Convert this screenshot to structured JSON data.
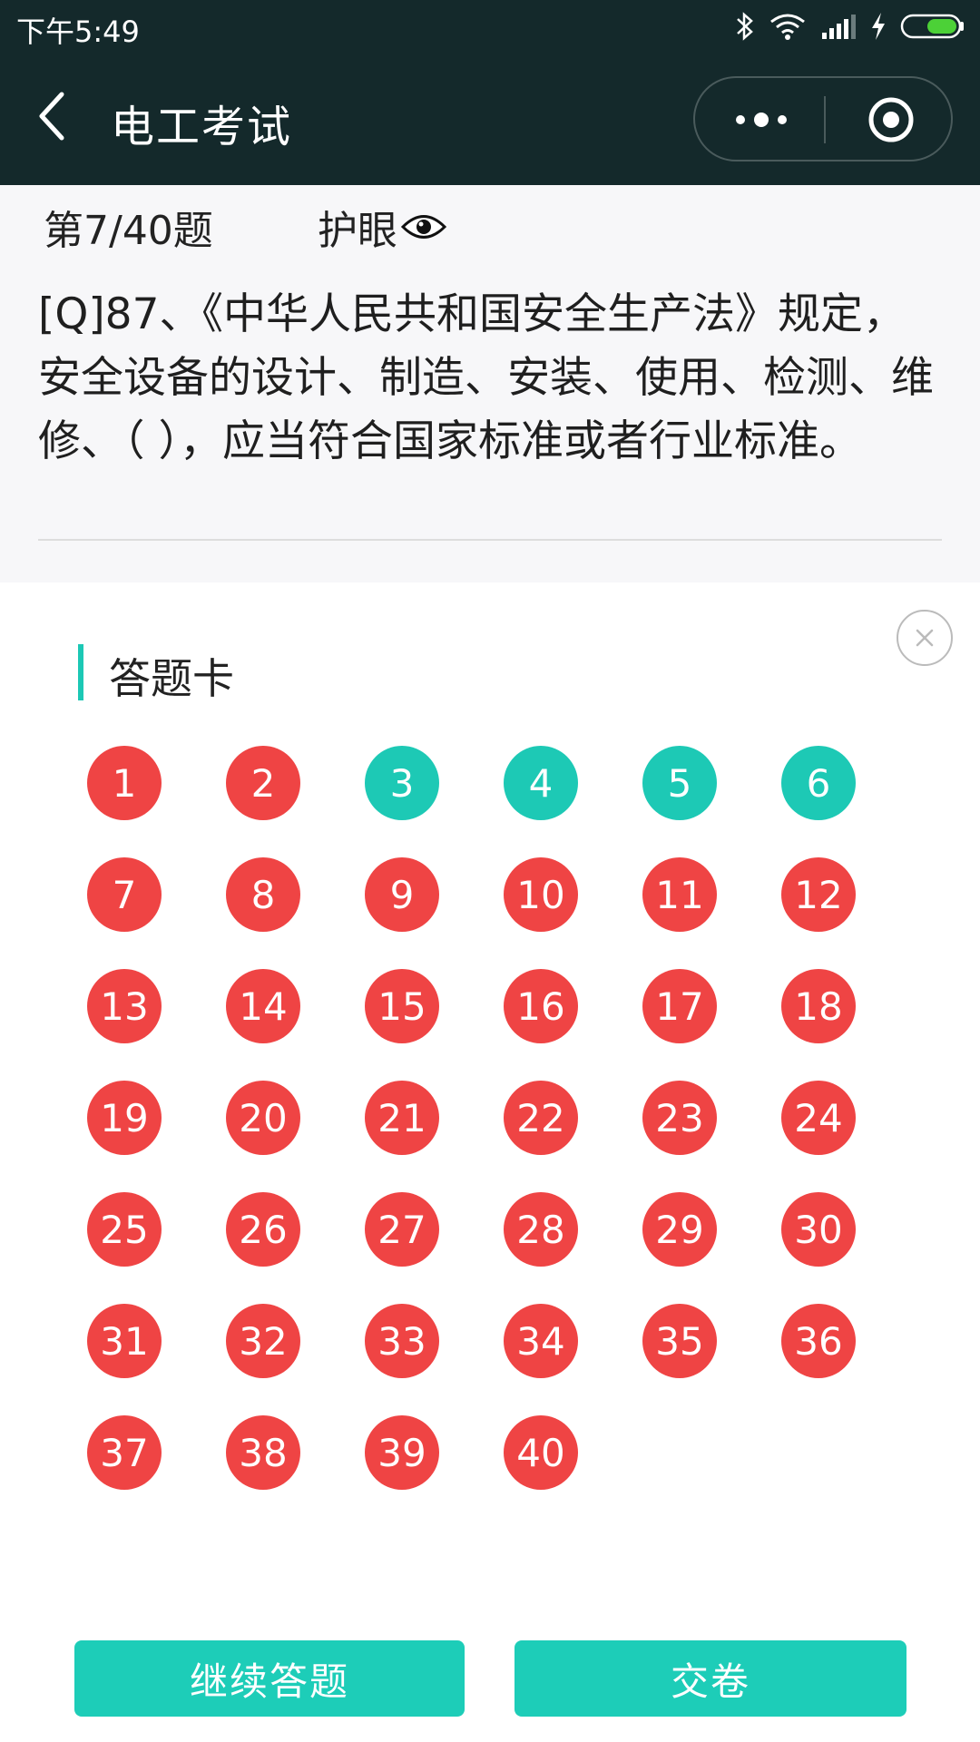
{
  "status_bar": {
    "time": "下午5:49"
  },
  "nav": {
    "title": "电工考试"
  },
  "question": {
    "progress": "第7/40题",
    "eye_mode_label": "护眼",
    "text": "[Q]87、《中华人民共和国安全生产法》规定，安全设备的设计、制造、安装、使用、检测、维修、（ ），应当符合国家标准或者行业标准。"
  },
  "answer_sheet": {
    "title": "答题卡",
    "items": [
      {
        "num": "1",
        "status": "wrong"
      },
      {
        "num": "2",
        "status": "wrong"
      },
      {
        "num": "3",
        "status": "correct"
      },
      {
        "num": "4",
        "status": "correct"
      },
      {
        "num": "5",
        "status": "correct"
      },
      {
        "num": "6",
        "status": "correct"
      },
      {
        "num": "7",
        "status": "wrong"
      },
      {
        "num": "8",
        "status": "wrong"
      },
      {
        "num": "9",
        "status": "wrong"
      },
      {
        "num": "10",
        "status": "wrong"
      },
      {
        "num": "11",
        "status": "wrong"
      },
      {
        "num": "12",
        "status": "wrong"
      },
      {
        "num": "13",
        "status": "wrong"
      },
      {
        "num": "14",
        "status": "wrong"
      },
      {
        "num": "15",
        "status": "wrong"
      },
      {
        "num": "16",
        "status": "wrong"
      },
      {
        "num": "17",
        "status": "wrong"
      },
      {
        "num": "18",
        "status": "wrong"
      },
      {
        "num": "19",
        "status": "wrong"
      },
      {
        "num": "20",
        "status": "wrong"
      },
      {
        "num": "21",
        "status": "wrong"
      },
      {
        "num": "22",
        "status": "wrong"
      },
      {
        "num": "23",
        "status": "wrong"
      },
      {
        "num": "24",
        "status": "wrong"
      },
      {
        "num": "25",
        "status": "wrong"
      },
      {
        "num": "26",
        "status": "wrong"
      },
      {
        "num": "27",
        "status": "wrong"
      },
      {
        "num": "28",
        "status": "wrong"
      },
      {
        "num": "29",
        "status": "wrong"
      },
      {
        "num": "30",
        "status": "wrong"
      },
      {
        "num": "31",
        "status": "wrong"
      },
      {
        "num": "32",
        "status": "wrong"
      },
      {
        "num": "33",
        "status": "wrong"
      },
      {
        "num": "34",
        "status": "wrong"
      },
      {
        "num": "35",
        "status": "wrong"
      },
      {
        "num": "36",
        "status": "wrong"
      },
      {
        "num": "37",
        "status": "wrong"
      },
      {
        "num": "38",
        "status": "wrong"
      },
      {
        "num": "39",
        "status": "wrong"
      },
      {
        "num": "40",
        "status": "wrong"
      }
    ]
  },
  "buttons": {
    "continue_label": "继续答题",
    "submit_label": "交卷"
  },
  "colors": {
    "wrong": "#ef4444",
    "correct": "#1dc9b5",
    "accent": "#1dcdb8",
    "nav_bg": "#14292b"
  },
  "icons": {
    "back": "chevron-left-icon",
    "more": "more-dots-icon",
    "mini_program_close": "target-circle-icon",
    "eye": "eye-icon",
    "sheet_close": "close-circle-icon",
    "bluetooth": "bluetooth-icon",
    "wifi": "wifi-icon",
    "signal": "signal-icon",
    "charging": "bolt-icon",
    "battery": "battery-icon"
  }
}
